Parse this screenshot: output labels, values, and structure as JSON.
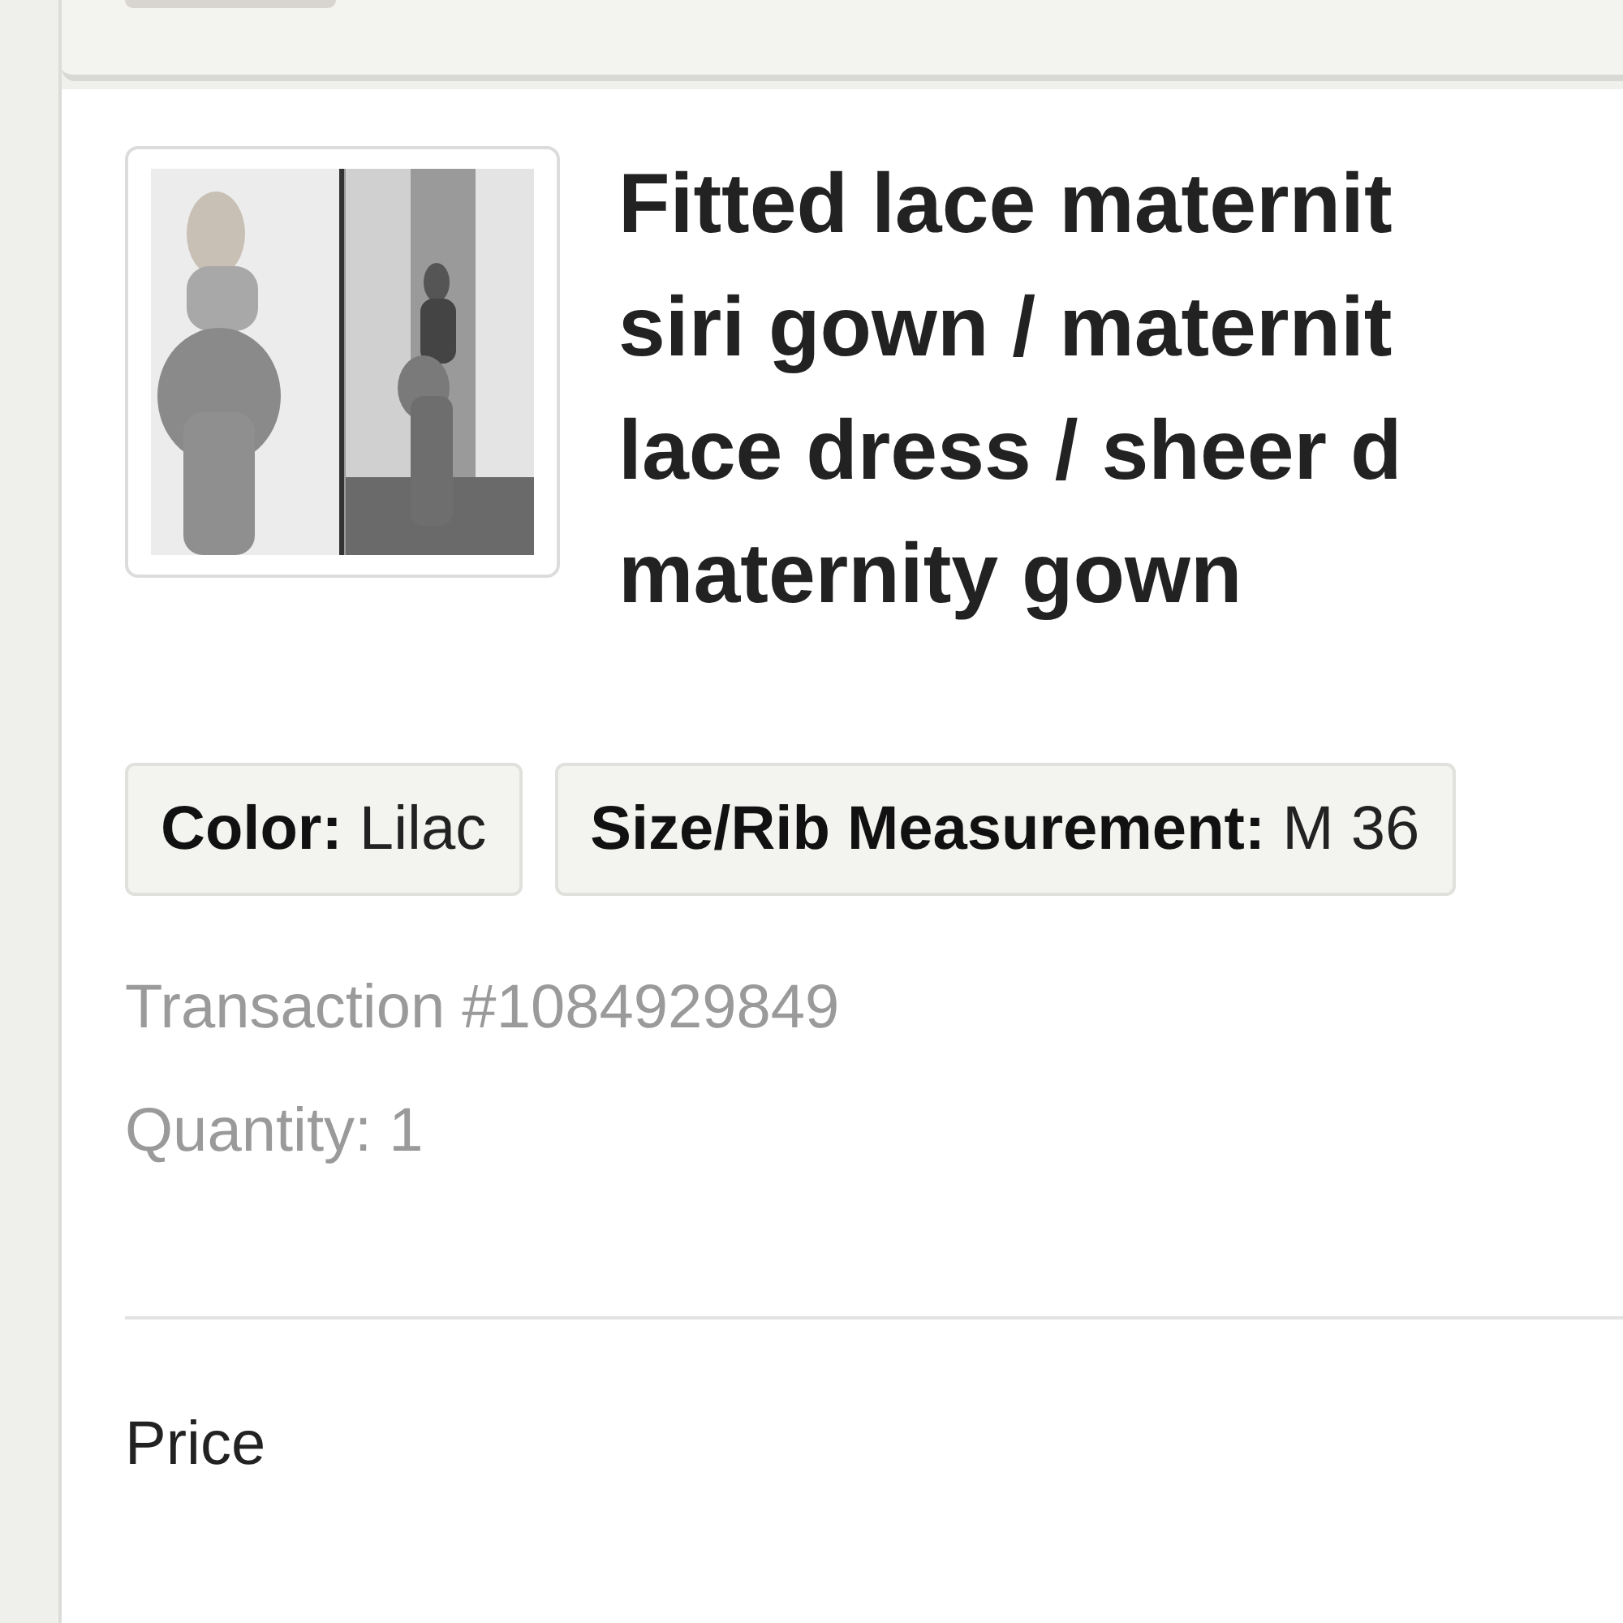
{
  "item": {
    "title_lines": [
      "Fitted lace maternit",
      "siri gown / maternit",
      "lace dress / sheer d",
      "maternity gown"
    ],
    "variations": [
      {
        "label": "Color:",
        "value": "Lilac"
      },
      {
        "label": "Size/Rib Measurement:",
        "value": "M 36"
      }
    ],
    "transaction": "Transaction #1084929849",
    "quantity": "Quantity: 1"
  },
  "price_label": "Price"
}
